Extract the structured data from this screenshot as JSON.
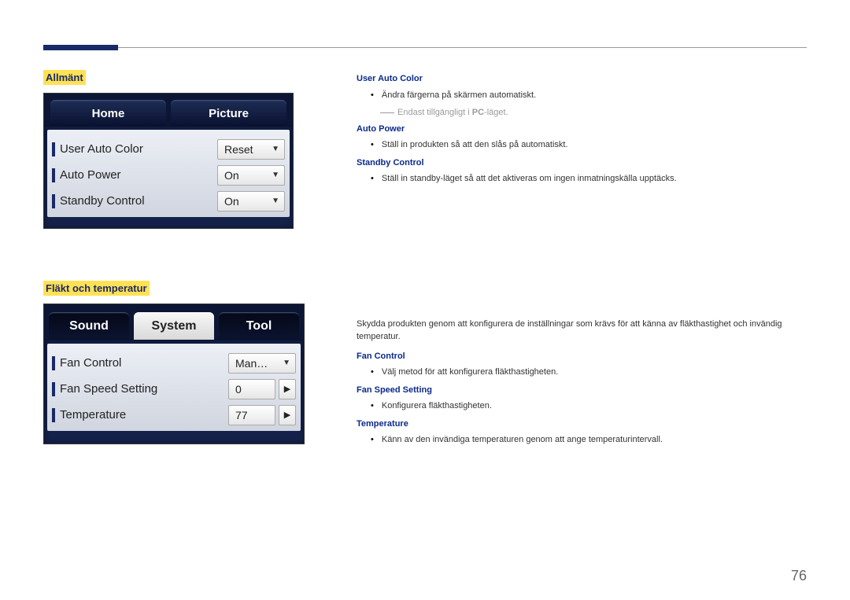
{
  "page_number": "76",
  "sections": {
    "general": {
      "heading": "Allmänt",
      "tabs": [
        "Home",
        "Picture"
      ],
      "active_tab": 0,
      "rows": [
        {
          "label": "User Auto Color",
          "value": "Reset"
        },
        {
          "label": "Auto Power",
          "value": "On"
        },
        {
          "label": "Standby Control",
          "value": "On"
        }
      ]
    },
    "fan": {
      "heading": "Fläkt och temperatur",
      "tabs": [
        "Sound",
        "System",
        "Tool"
      ],
      "active_tab": 1,
      "rows": [
        {
          "label": "Fan Control",
          "type": "dd",
          "value": "Man…"
        },
        {
          "label": "Fan Speed Setting",
          "type": "spin",
          "value": "0"
        },
        {
          "label": "Temperature",
          "type": "spin",
          "value": "77"
        }
      ]
    }
  },
  "right": {
    "general": {
      "items": [
        {
          "title": "User Auto Color",
          "bullet": "Ändra färgerna på skärmen automatiskt.",
          "note_prefix": "Endast tillgängligt i ",
          "note_strong": "PC",
          "note_suffix": "-läget."
        },
        {
          "title": "Auto Power",
          "bullet": "Ställ in produkten så att den slås på automatiskt."
        },
        {
          "title": "Standby Control",
          "bullet": "Ställ in standby-läget så att det aktiveras om ingen inmatningskälla upptäcks."
        }
      ]
    },
    "fan": {
      "intro": "Skydda produkten genom att konfigurera de inställningar som krävs för att känna av fläkthastighet och invändig temperatur.",
      "items": [
        {
          "title": "Fan Control",
          "bullet": "Välj metod för att konfigurera fläkthastigheten."
        },
        {
          "title": "Fan Speed Setting",
          "bullet": "Konfigurera fläkthastigheten."
        },
        {
          "title": "Temperature",
          "bullet": "Känn av den invändiga temperaturen genom att ange temperaturintervall."
        }
      ]
    }
  }
}
